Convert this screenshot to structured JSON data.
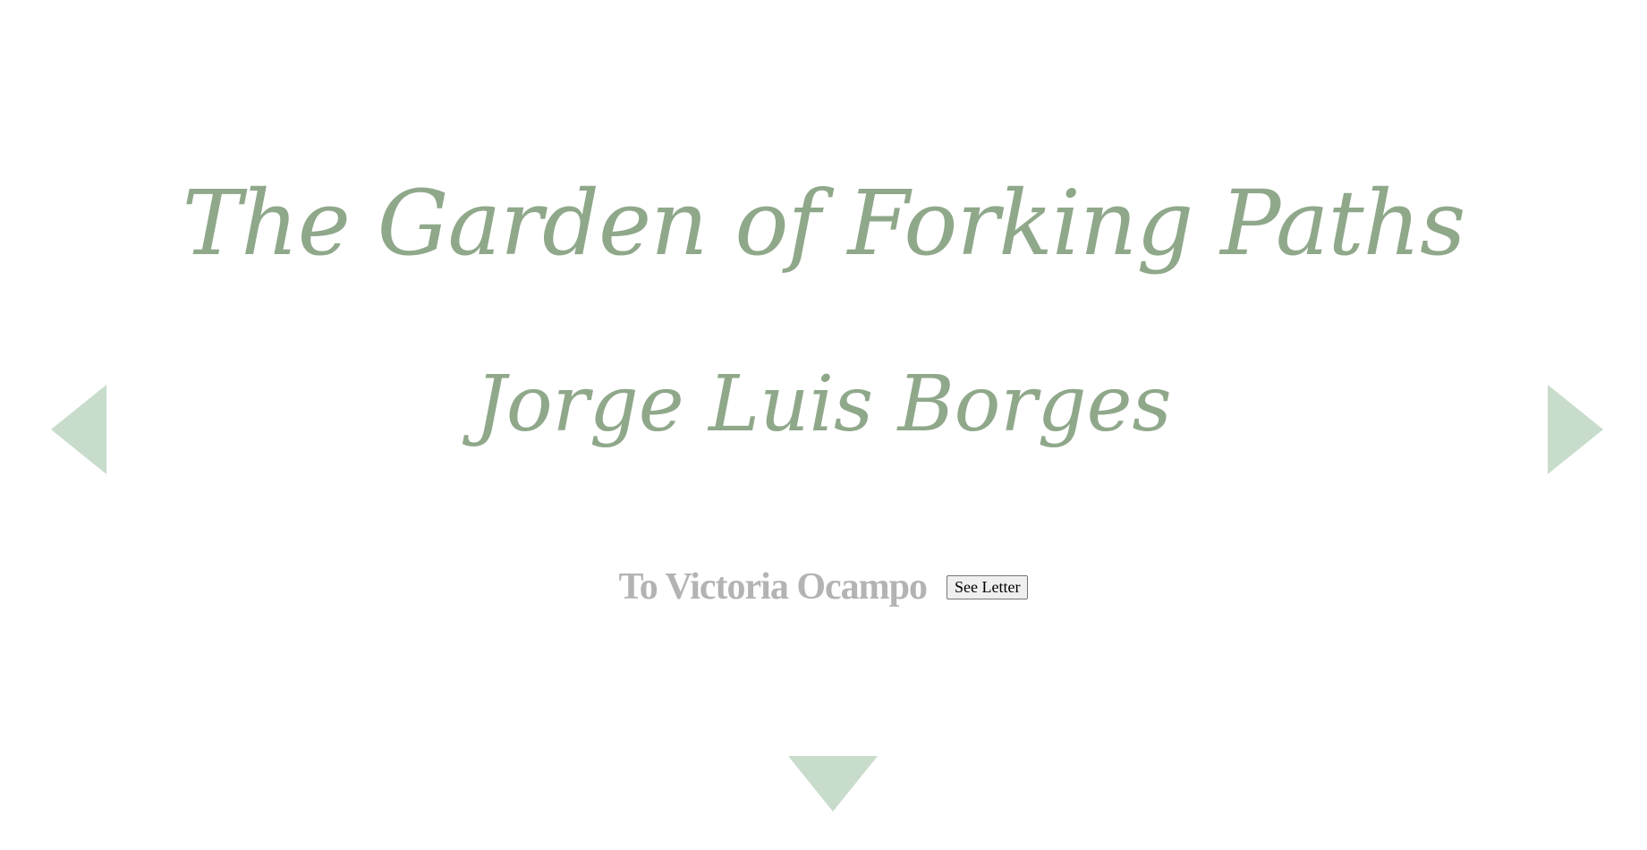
{
  "title": "The Garden of Forking Paths",
  "author": "Jorge Luis Borges",
  "dedication": "To Victoria Ocampo",
  "buttons": {
    "see_letter": "See Letter"
  },
  "navigation": {
    "previous": "arrow-left-icon",
    "next": "arrow-right-icon",
    "down": "arrow-down-icon"
  },
  "colors": {
    "title": "#8fa88a",
    "dedication": "#b3b3b3",
    "arrows": "#c8dccb"
  }
}
